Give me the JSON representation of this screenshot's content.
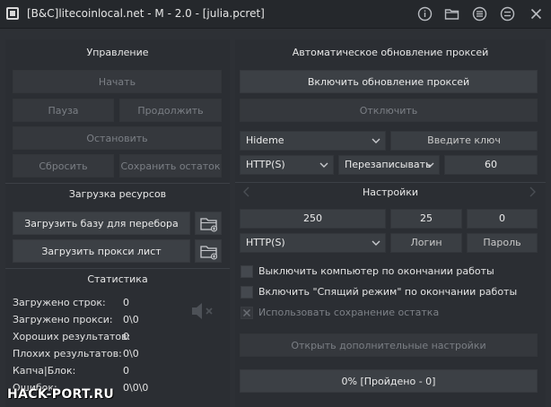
{
  "window": {
    "title": "[B&C]litecoinlocal.net - M - 2.0 - [julia.pcret]",
    "icons": [
      "app-icon",
      "info-icon",
      "folder-icon",
      "list-icon",
      "menu-icon",
      "close-icon"
    ]
  },
  "control": {
    "header": "Управление",
    "start": "Начать",
    "pause": "Пауза",
    "continue": "Продолжить",
    "stop": "Остановить",
    "reset": "Сбросить",
    "save_rest": "Сохранить остаток"
  },
  "resources": {
    "header": "Загрузка ресурсов",
    "load_base": "Загрузить базу для перебора",
    "load_proxy": "Загрузить прокси лист"
  },
  "stats": {
    "header": "Статистика",
    "rows": [
      {
        "label": "Загружено строк:",
        "value": "0"
      },
      {
        "label": "Загружено прокси:",
        "value": "0\\0"
      },
      {
        "label": "Хороших результатов:",
        "value": "0"
      },
      {
        "label": "Плохих результатов:",
        "value": "0\\0"
      },
      {
        "label": "Капча|Блок:",
        "value": "0"
      },
      {
        "label": "Ошибок:",
        "value": "0\\0\\0"
      }
    ]
  },
  "proxy_update": {
    "header": "Автоматическое обновление проксей",
    "enable": "Включить обновление проксей",
    "disable": "Отключить",
    "source": "Hideme",
    "key_placeholder": "Введите ключ",
    "protocol": "HTTP(S)",
    "mode": "Перезаписывать",
    "interval": "60"
  },
  "settings": {
    "header": "Настройки",
    "threads": "250",
    "timeout": "25",
    "retries": "0",
    "protocol": "HTTP(S)",
    "login_placeholder": "Логин",
    "password_placeholder": "Пароль",
    "shutdown_label": "Выключить компьютер по окончании работы",
    "sleep_label": "Включить \"Спящий режим\" по окончании работы",
    "save_rest_label": "Использовать сохранение остатка",
    "advanced": "Открыть дополнительные настройки",
    "progress": "0% [Пройдено - 0]"
  },
  "watermark": "HACK-PORT.RU",
  "colors": {
    "background": "#2d3035",
    "button": "#3c4045",
    "text": "#e2e2e2",
    "disabled_text": "#7b7f85"
  }
}
